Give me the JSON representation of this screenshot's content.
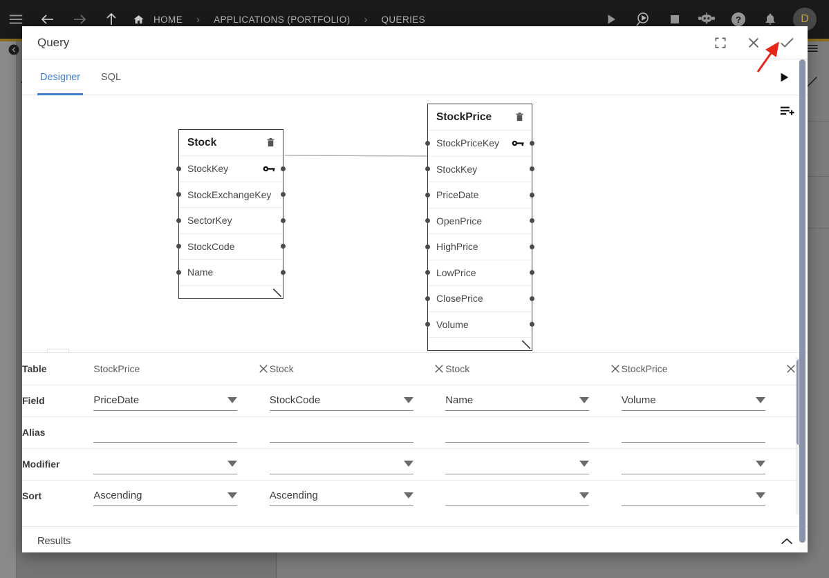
{
  "topbar": {
    "menu_icon": "hamburger-icon",
    "back_icon": "arrow-left-icon",
    "forward_icon": "arrow-right-icon",
    "up_icon": "arrow-up-icon",
    "home_icon": "home-icon",
    "breadcrumbs": [
      "HOME",
      "APPLICATIONS (PORTFOLIO)",
      "QUERIES"
    ],
    "separator": "›",
    "actions": [
      {
        "name": "run-icon",
        "glyph": "play"
      },
      {
        "name": "debug-icon",
        "glyph": "play-search"
      },
      {
        "name": "stop-icon",
        "glyph": "square"
      },
      {
        "name": "assistant-icon",
        "glyph": "robot"
      },
      {
        "name": "help-icon",
        "glyph": "question"
      },
      {
        "name": "notifications-icon",
        "glyph": "bell"
      }
    ],
    "avatar_initial": "D"
  },
  "modal": {
    "title": "Query",
    "header_actions": [
      {
        "name": "fullscreen-icon",
        "label": "fullscreen"
      },
      {
        "name": "close-icon",
        "label": "close"
      },
      {
        "name": "confirm-check-icon",
        "label": "confirm"
      }
    ],
    "tabs": [
      {
        "label": "Designer",
        "active": true
      },
      {
        "label": "SQL",
        "active": false
      }
    ],
    "run_button": "run-query-icon",
    "add_table_icon": "add-to-list-icon"
  },
  "canvas": {
    "zoom_controls": [
      {
        "name": "zoom-in-button",
        "glyph": "+"
      },
      {
        "name": "zoom-out-button",
        "glyph": "−"
      },
      {
        "name": "fit-to-screen-button",
        "glyph": "fit"
      },
      {
        "name": "lock-button",
        "glyph": "lock-open"
      }
    ],
    "entities": [
      {
        "name": "Stock",
        "delete_icon": "trash-icon",
        "fields": [
          {
            "label": "StockKey",
            "key": true
          },
          {
            "label": "StockExchangeKey",
            "key": false
          },
          {
            "label": "SectorKey",
            "key": false
          },
          {
            "label": "StockCode",
            "key": false
          },
          {
            "label": "Name",
            "key": false
          }
        ]
      },
      {
        "name": "StockPrice",
        "delete_icon": "trash-icon",
        "fields": [
          {
            "label": "StockPriceKey",
            "key": true
          },
          {
            "label": "StockKey",
            "key": false
          },
          {
            "label": "PriceDate",
            "key": false
          },
          {
            "label": "OpenPrice",
            "key": false
          },
          {
            "label": "HighPrice",
            "key": false
          },
          {
            "label": "LowPrice",
            "key": false
          },
          {
            "label": "ClosePrice",
            "key": false
          },
          {
            "label": "Volume",
            "key": false
          }
        ]
      }
    ],
    "join": {
      "from": "Stock.StockKey",
      "to": "StockPrice.StockKey"
    }
  },
  "grid": {
    "row_labels": [
      "Table",
      "Field",
      "Alias",
      "Modifier",
      "Sort"
    ],
    "columns": [
      {
        "table": "StockPrice",
        "field": "PriceDate",
        "alias": "",
        "modifier": "",
        "sort": "Ascending"
      },
      {
        "table": "Stock",
        "field": "StockCode",
        "alias": "",
        "modifier": "",
        "sort": "Ascending"
      },
      {
        "table": "Stock",
        "field": "Name",
        "alias": "",
        "modifier": "",
        "sort": ""
      },
      {
        "table": "StockPrice",
        "field": "Volume",
        "alias": "",
        "modifier": "",
        "sort": ""
      }
    ],
    "remove_icon": "close-icon",
    "dropdown_icon": "caret-down-icon"
  },
  "results": {
    "label": "Results",
    "collapse_icon": "chevron-up-icon"
  },
  "colors": {
    "accent": "#3f7fd0",
    "topbar_bg": "#1a1a1a",
    "annotation_arrow": "#e8271c",
    "scrollbar_thumb": "#8b93a8"
  }
}
